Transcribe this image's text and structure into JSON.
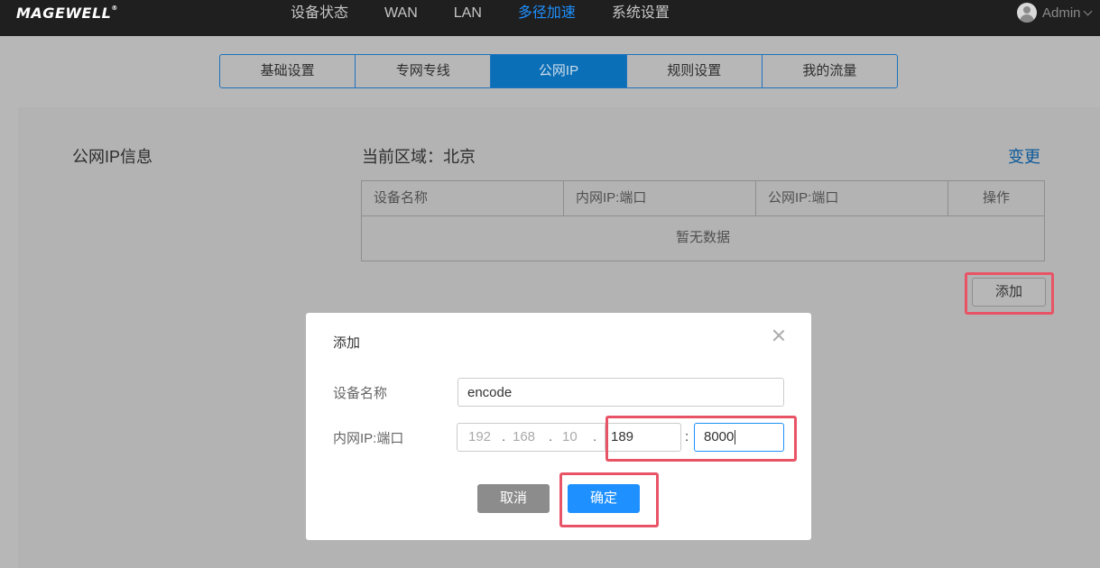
{
  "header": {
    "logo": "MAGEWELL",
    "logo_mark": "®",
    "nav": [
      {
        "label": "设备状态",
        "active": false
      },
      {
        "label": "WAN",
        "active": false
      },
      {
        "label": "LAN",
        "active": false
      },
      {
        "label": "多径加速",
        "active": true
      },
      {
        "label": "系统设置",
        "active": false
      }
    ],
    "user": "Admin"
  },
  "subtabs": [
    {
      "label": "基础设置",
      "active": false
    },
    {
      "label": "专网专线",
      "active": false
    },
    {
      "label": "公网IP",
      "active": true
    },
    {
      "label": "规则设置",
      "active": false
    },
    {
      "label": "我的流量",
      "active": false
    }
  ],
  "section": {
    "title": "公网IP信息",
    "region": "当前区域：北京",
    "change_link": "变更",
    "table": {
      "columns": [
        "设备名称",
        "内网IP:端口",
        "公网IP:端口",
        "操作"
      ],
      "empty_text": "暂无数据"
    },
    "add_button": "添加"
  },
  "modal": {
    "title": "添加",
    "device_name_label": "设备名称",
    "device_name_value": "encode",
    "ip_label": "内网IP:端口",
    "ip_segments": [
      "192",
      "168",
      "10",
      "189"
    ],
    "ip_separator": ".",
    "port_separator": ":",
    "port_value": "8000",
    "cancel_button": "取消",
    "ok_button": "确定"
  },
  "colors": {
    "accent": "#1e90ff",
    "highlight": "#e85466",
    "topbar": "#1f1f1f",
    "active_tab": "#0b6fb8"
  }
}
